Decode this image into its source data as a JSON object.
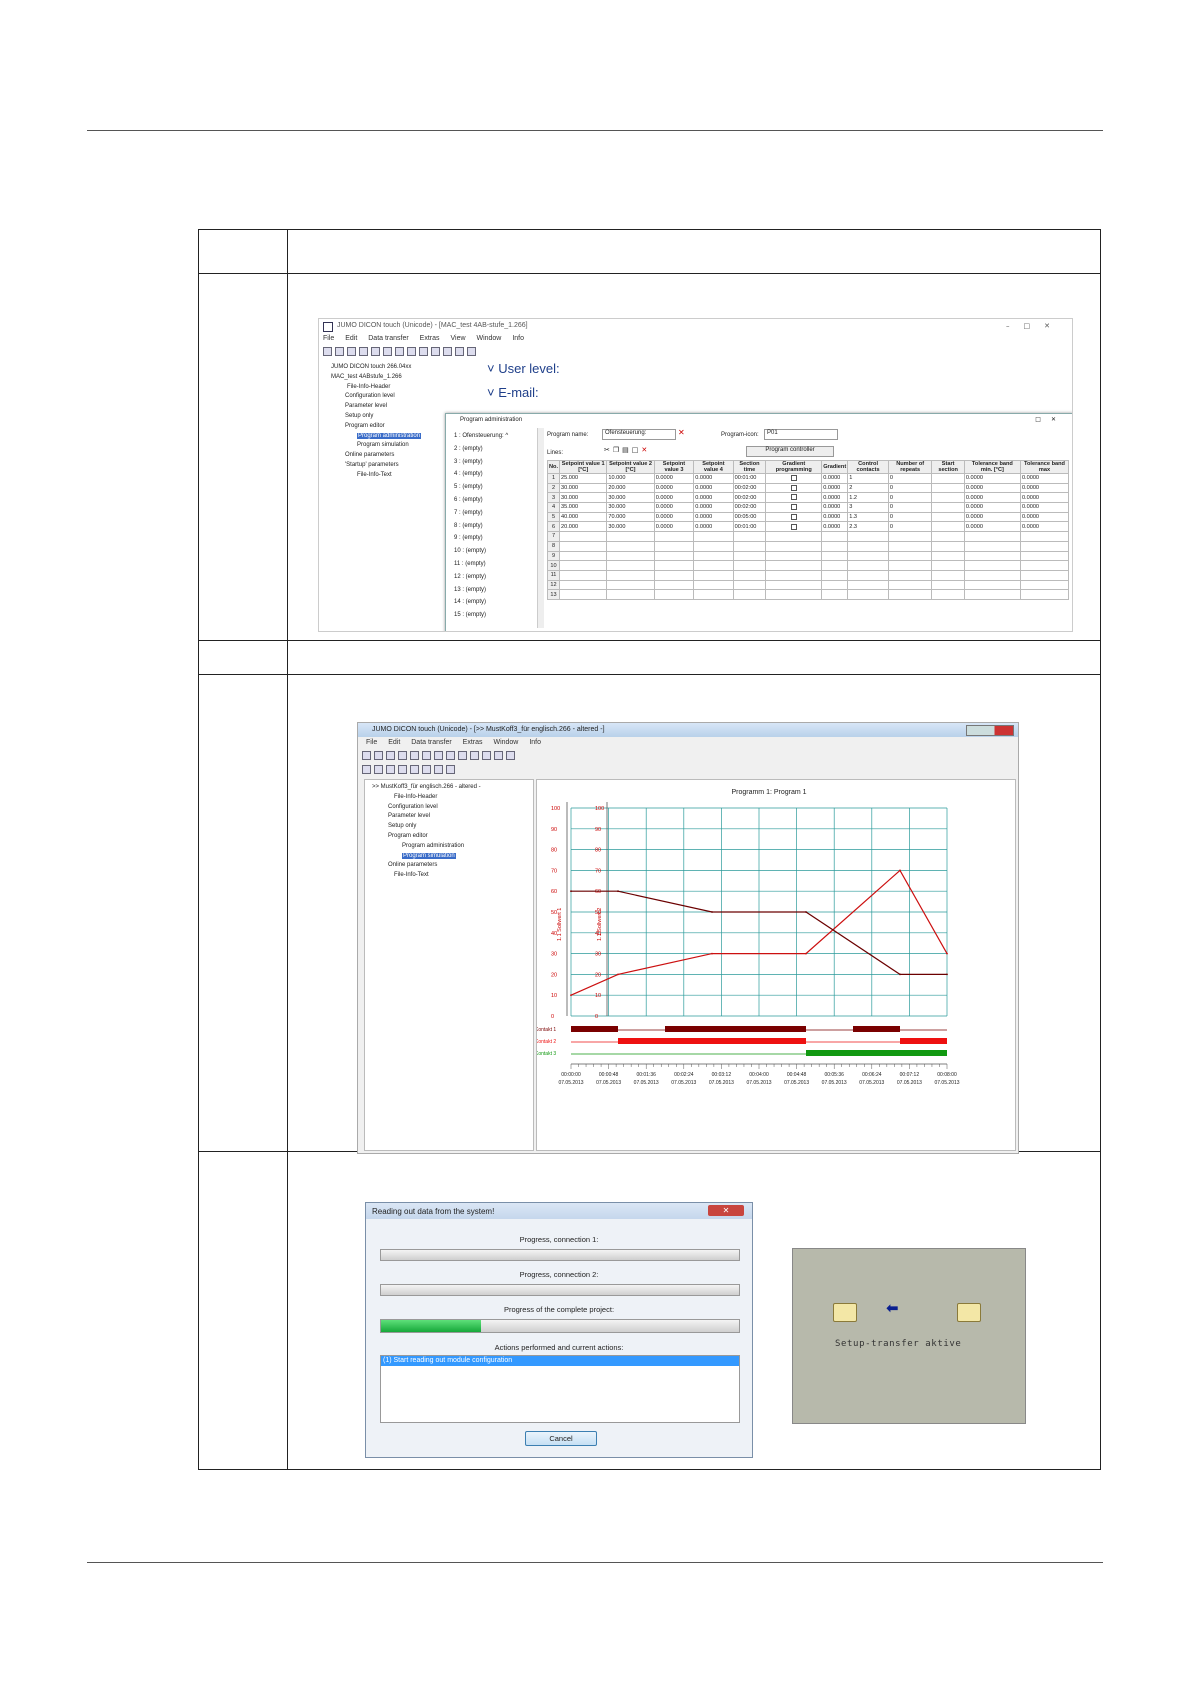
{
  "screen1": {
    "title": "JUMO DICON touch (Unicode) - [MAC_test 4AB-stufe_1.266]",
    "menu": [
      "File",
      "Edit",
      "Data transfer",
      "Extras",
      "View",
      "Window",
      "Info"
    ],
    "tree": [
      "JUMO DICON touch 266.04xx",
      "MAC_test 4ABstufe_1.266",
      "File-Info-Header",
      "Configuration level",
      "Parameter level",
      "Setup only",
      "Program editor",
      "Program administration",
      "Program simulation",
      "Online parameters",
      "'Startup' parameters",
      "File-Info-Text"
    ],
    "user_level": "User level:",
    "email": "E-mail:",
    "dialog": {
      "title": "Program administration",
      "programs": [
        "1 : Ofensteuerung: ^",
        "2 : (empty)",
        "3 : (empty)",
        "4 : (empty)",
        "5 : (empty)",
        "6 : (empty)",
        "7 : (empty)",
        "8 : (empty)",
        "9 : (empty)",
        "10 : (empty)",
        "11 : (empty)",
        "12 : (empty)",
        "13 : (empty)",
        "14 : (empty)",
        "15 : (empty)"
      ],
      "program_name_label": "Program name:",
      "program_name_value": "Ofensteuerung:",
      "program_icon_label": "Program-icon:",
      "program_icon_value": "P01",
      "lines_label": "Lines:",
      "program_controller_button": "Program controller",
      "columns": [
        "No.",
        "Setpoint value 1 [°C]",
        "Setpoint value 2 [°C]",
        "Setpoint value 3",
        "Setpoint value 4",
        "Section time",
        "Gradient programming",
        "Gradient",
        "Control contacts",
        "Number of repeats",
        "Start section",
        "Tolerance band min. [°C]",
        "Tolerance band max"
      ],
      "rows": [
        [
          "1",
          "25.000",
          "10.000",
          "0.0000",
          "0.0000",
          "00:01:00",
          "",
          "0.0000",
          "1",
          "0",
          "",
          "0.0000",
          "0.0000"
        ],
        [
          "2",
          "30.000",
          "20.000",
          "0.0000",
          "0.0000",
          "00:02:00",
          "",
          "0.0000",
          "2",
          "0",
          "",
          "0.0000",
          "0.0000"
        ],
        [
          "3",
          "30.000",
          "30.000",
          "0.0000",
          "0.0000",
          "00:02:00",
          "",
          "0.0000",
          "1.2",
          "0",
          "",
          "0.0000",
          "0.0000"
        ],
        [
          "4",
          "35.000",
          "30.000",
          "0.0000",
          "0.0000",
          "00:02:00",
          "",
          "0.0000",
          "3",
          "0",
          "",
          "0.0000",
          "0.0000"
        ],
        [
          "5",
          "40.000",
          "70.000",
          "0.0000",
          "0.0000",
          "00:05:00",
          "",
          "0.0000",
          "1.3",
          "0",
          "",
          "0.0000",
          "0.0000"
        ],
        [
          "6",
          "20.000",
          "30.000",
          "0.0000",
          "0.0000",
          "00:01:00",
          "",
          "0.0000",
          "2.3",
          "0",
          "",
          "0.0000",
          "0.0000"
        ],
        [
          "7",
          "",
          "",
          "",
          "",
          "",
          "",
          "",
          "",
          "",
          "",
          "",
          ""
        ],
        [
          "8",
          "",
          "",
          "",
          "",
          "",
          "",
          "",
          "",
          "",
          "",
          "",
          ""
        ],
        [
          "9",
          "",
          "",
          "",
          "",
          "",
          "",
          "",
          "",
          "",
          "",
          "",
          ""
        ],
        [
          "10",
          "",
          "",
          "",
          "",
          "",
          "",
          "",
          "",
          "",
          "",
          "",
          ""
        ],
        [
          "11",
          "",
          "",
          "",
          "",
          "",
          "",
          "",
          "",
          "",
          "",
          "",
          ""
        ],
        [
          "12",
          "",
          "",
          "",
          "",
          "",
          "",
          "",
          "",
          "",
          "",
          "",
          ""
        ],
        [
          "13",
          "",
          "",
          "",
          "",
          "",
          "",
          "",
          "",
          "",
          "",
          "",
          ""
        ]
      ]
    }
  },
  "screen2": {
    "title": "JUMO DICON touch (Unicode) - [>> MustKoff3_für englisch.266 - altered -]",
    "menu": [
      "File",
      "Edit",
      "Data transfer",
      "Extras",
      "Window",
      "Info"
    ],
    "tree": [
      ">> MustKoff3_für englisch.266 - altered -",
      "File-Info-Header",
      "Configuration level",
      "Parameter level",
      "Setup only",
      "Program editor",
      "Program administration",
      "Program simulation",
      "Online parameters",
      "File-Info-Text"
    ]
  },
  "chart_data": {
    "type": "line",
    "title": "Programm 1: Program 1",
    "ylabel_left": "1.1 Sollwert 1",
    "ylabel_right": "1.1 Sollwert 2",
    "ylim": [
      0,
      100
    ],
    "yticks": [
      "100",
      "90",
      "80",
      "70",
      "60",
      "50",
      "40",
      "30",
      "20",
      "10",
      "0"
    ],
    "x_ticks": [
      {
        "time": "00:00:00",
        "date": "07.05.2013"
      },
      {
        "time": "00:00:48",
        "date": "07.05.2013"
      },
      {
        "time": "00:01:36",
        "date": "07.05.2013"
      },
      {
        "time": "00:02:24",
        "date": "07.05.2013"
      },
      {
        "time": "00:03:12",
        "date": "07.05.2013"
      },
      {
        "time": "00:04:00",
        "date": "07.05.2013"
      },
      {
        "time": "00:04:48",
        "date": "07.05.2013"
      },
      {
        "time": "00:05:36",
        "date": "07.05.2013"
      },
      {
        "time": "00:06:24",
        "date": "07.05.2013"
      },
      {
        "time": "00:07:12",
        "date": "07.05.2013"
      },
      {
        "time": "00:08:00",
        "date": "07.05.2013"
      }
    ],
    "xlim_seconds": [
      0,
      480
    ],
    "grid": true,
    "series": [
      {
        "color": "#cc1010",
        "x": [
          0,
          60,
          180,
          300,
          420,
          480
        ],
        "y": [
          10,
          20,
          30,
          30,
          70,
          30
        ]
      },
      {
        "color": "#6b0000",
        "x": [
          0,
          60,
          180,
          300,
          420,
          480
        ],
        "y": [
          60,
          60,
          50,
          50,
          20,
          20
        ]
      }
    ],
    "contacts": [
      {
        "name": "Kontakt 1",
        "color": "#7a0000",
        "on": [
          [
            0,
            60
          ],
          [
            120,
            300
          ],
          [
            360,
            420
          ]
        ]
      },
      {
        "name": "Kontakt 2",
        "color": "#ee1111",
        "on": [
          [
            60,
            300
          ],
          [
            420,
            480
          ]
        ]
      },
      {
        "name": "Kontakt 3",
        "color": "#119911",
        "on": [
          [
            300,
            480
          ]
        ]
      }
    ]
  },
  "screen3": {
    "title": "Reading out data from the system!",
    "progress1_label": "Progress, connection 1:",
    "progress1_value": 0,
    "progress2_label": "Progress, connection 2:",
    "progress2_value": 0,
    "progress3_label": "Progress of the complete project:",
    "progress3_value": 0.28,
    "actions_label": "Actions performed and current actions:",
    "action_1": "(1) Start reading out module configuration",
    "cancel": "Cancel"
  },
  "screen4": {
    "text": "Setup-transfer aktive",
    "colors": {
      "background": "#b7b9ab",
      "folder": "#f3e7a6",
      "arrow": "#0a1f8f"
    }
  }
}
